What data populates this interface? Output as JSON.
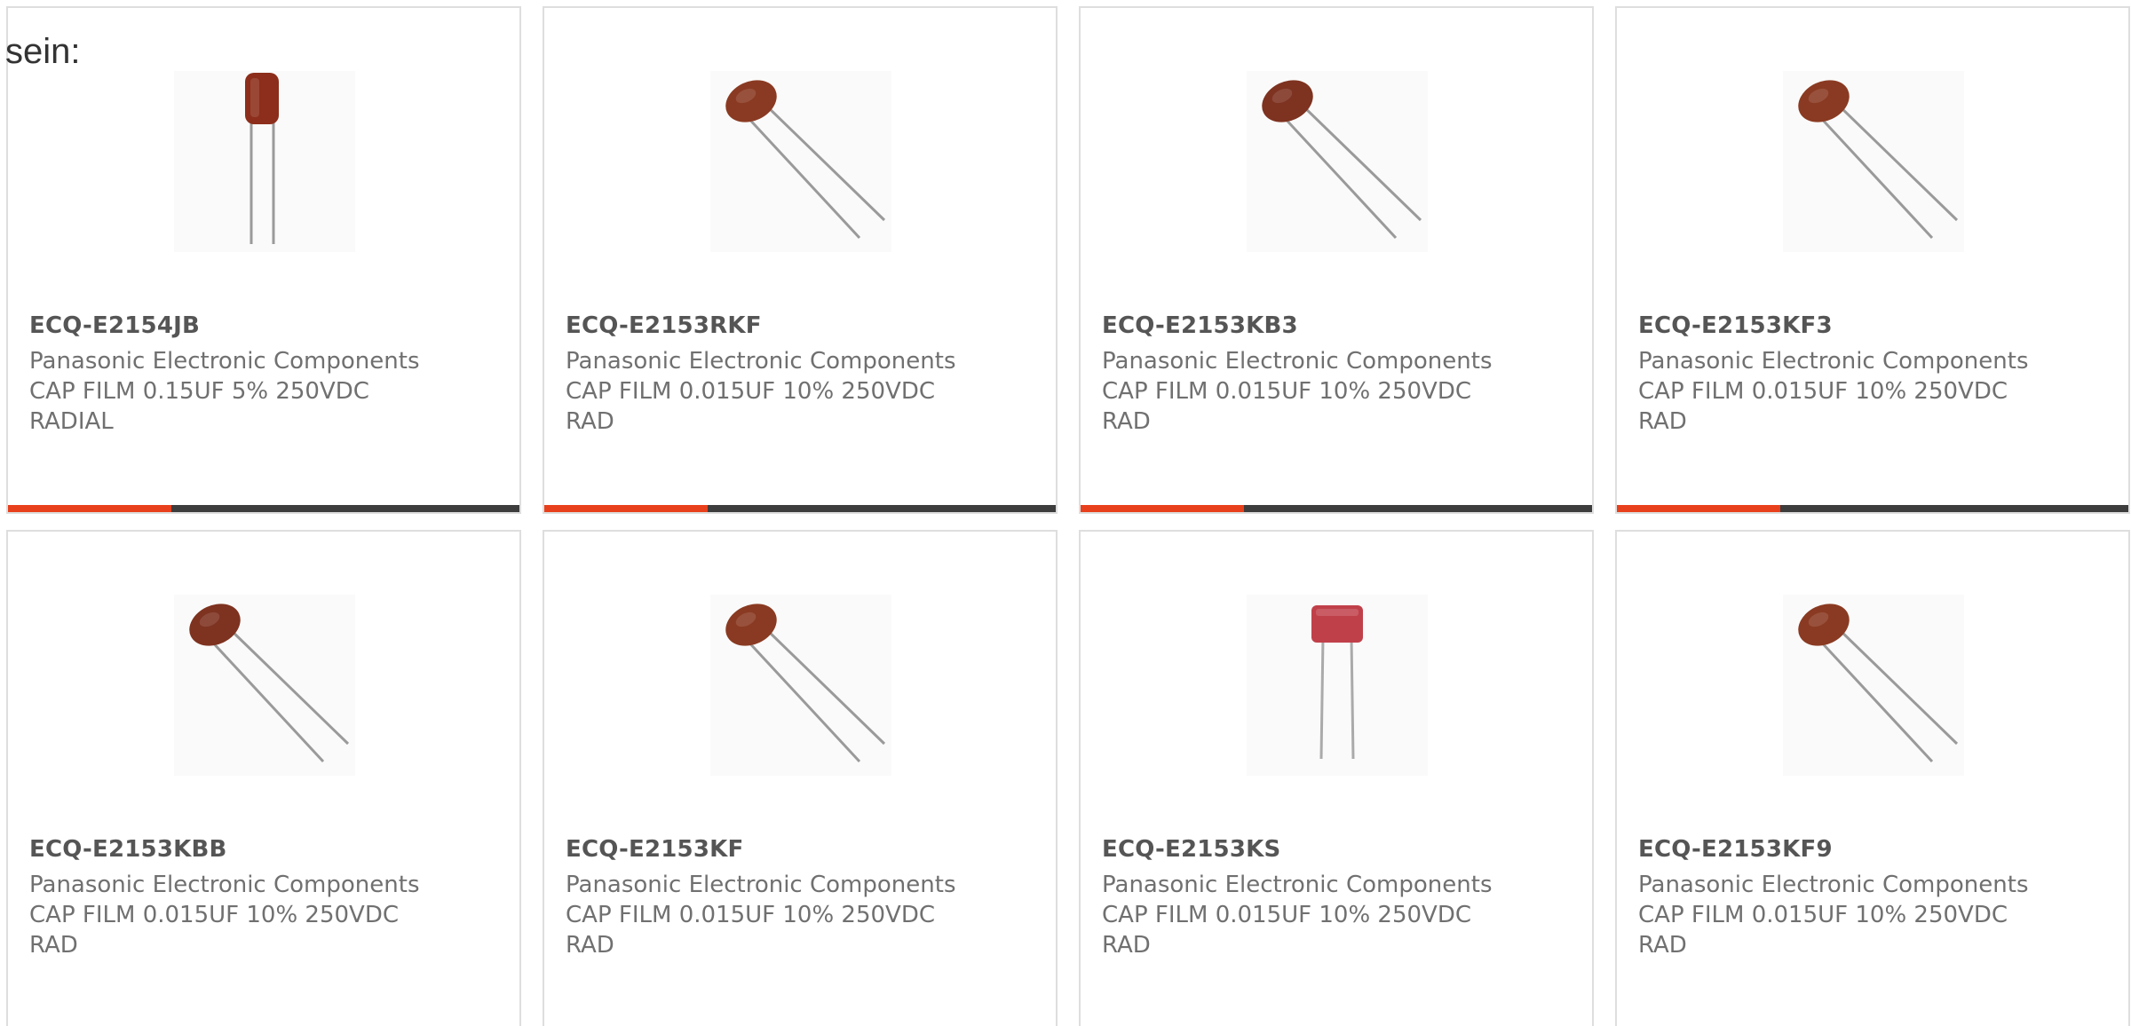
{
  "intro_text": "sein:",
  "products": [
    {
      "part_number": "ECQ-E2154JB",
      "manufacturer": "Panasonic Electronic Components",
      "description": "CAP FILM 0.15UF 5% 250VDC RADIAL",
      "image": "capacitor-upright-icon",
      "body_color": "#8c2e1b",
      "progress": 0.32
    },
    {
      "part_number": "ECQ-E2153RKF",
      "manufacturer": "Panasonic Electronic Components",
      "description": "CAP FILM 0.015UF 10% 250VDC RAD",
      "image": "capacitor-tilted-icon",
      "body_color": "#8a3a22",
      "progress": 0.32
    },
    {
      "part_number": "ECQ-E2153KB3",
      "manufacturer": "Panasonic Electronic Components",
      "description": "CAP FILM 0.015UF 10% 250VDC RAD",
      "image": "capacitor-tilted-icon",
      "body_color": "#7e3220",
      "progress": 0.32
    },
    {
      "part_number": "ECQ-E2153KF3",
      "manufacturer": "Panasonic Electronic Components",
      "description": "CAP FILM 0.015UF 10% 250VDC RAD",
      "image": "capacitor-tilted-icon",
      "body_color": "#8a3a22",
      "progress": 0.32
    },
    {
      "part_number": "ECQ-E2153KBB",
      "manufacturer": "Panasonic Electronic Components",
      "description": "CAP FILM 0.015UF 10% 250VDC RAD",
      "image": "capacitor-tilted-icon",
      "body_color": "#7e3220",
      "progress": null
    },
    {
      "part_number": "ECQ-E2153KF",
      "manufacturer": "Panasonic Electronic Components",
      "description": "CAP FILM 0.015UF 10% 250VDC RAD",
      "image": "capacitor-tilted-icon",
      "body_color": "#8a3a22",
      "progress": null
    },
    {
      "part_number": "ECQ-E2153KS",
      "manufacturer": "Panasonic Electronic Components",
      "description": "CAP FILM 0.015UF 10% 250VDC RAD",
      "image": "capacitor-red-box-icon",
      "body_color": "#c0404a",
      "progress": null
    },
    {
      "part_number": "ECQ-E2153KF9",
      "manufacturer": "Panasonic Electronic Components",
      "description": "CAP FILM 0.015UF 10% 250VDC RAD",
      "image": "capacitor-tilted-icon",
      "body_color": "#8a3a22",
      "progress": null
    }
  ],
  "colors": {
    "accent": "#e8401c",
    "bar_track": "#3d3d3d",
    "card_border": "#dedede",
    "part_number_text": "#555555",
    "body_text": "#707070"
  }
}
